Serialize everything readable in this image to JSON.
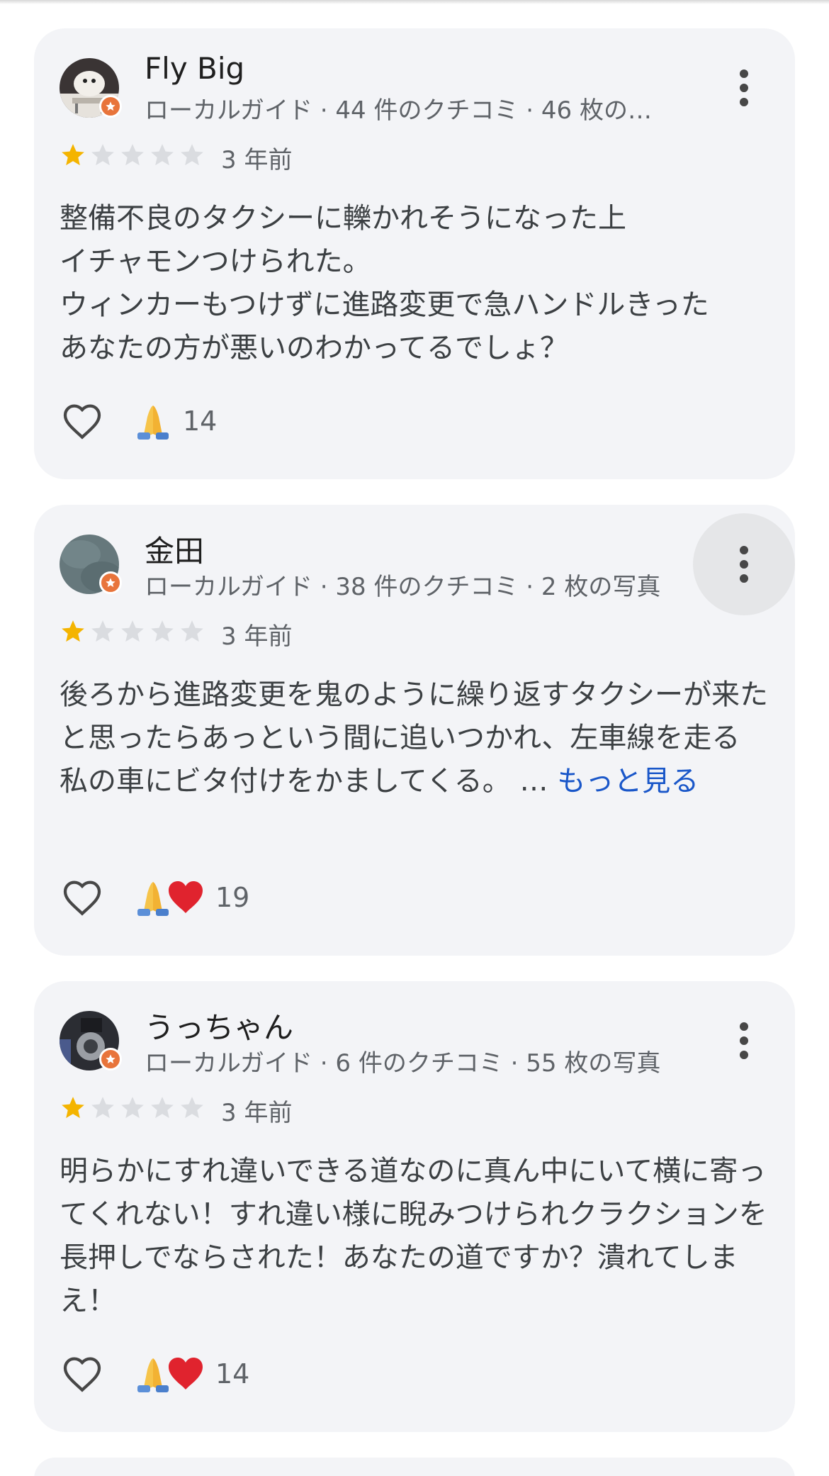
{
  "reviews": [
    {
      "name": "Fly Big",
      "meta": "ローカルガイド · 44 件のクチコミ · 46 枚の…",
      "rating": 1,
      "time": "3 年前",
      "text": "整備不良のタクシーに轢かれそうになった上\nイチャモンつけられた。\nウィンカーもつけずに進路変更で急ハンドルきった\nあなたの方が悪いのわかってるでしょ？",
      "more": "",
      "reactions": [
        "folded-hands-icon"
      ],
      "reaction_count": "14"
    },
    {
      "name": "金田",
      "meta": "ローカルガイド · 38 件のクチコミ · 2 枚の写真",
      "rating": 1,
      "time": "3 年前",
      "text": "後ろから進路変更を鬼のように繰り返すタクシーが来たと思ったらあっという間に追いつかれ、左車線を走る私の車にビタ付けをかましてくる。 … ",
      "more": "もっと見る",
      "reactions": [
        "folded-hands-icon",
        "red-heart-icon"
      ],
      "reaction_count": "19"
    },
    {
      "name": "うっちゃん",
      "meta": "ローカルガイド · 6 件のクチコミ · 55 枚の写真",
      "rating": 1,
      "time": "3 年前",
      "text": "明らかにすれ違いできる道なのに真ん中にいて横に寄ってくれない！すれ違い様に睨みつけられクラクションを長押しでならされた！あなたの道ですか？潰れてしまえ！",
      "more": "",
      "reactions": [
        "folded-hands-icon",
        "red-heart-icon"
      ],
      "reaction_count": "14"
    }
  ],
  "colors": {
    "card_bg": "#f3f4f7",
    "star_filled": "#f4b400",
    "star_empty": "#dadce0",
    "link": "#1a57c9",
    "guide_badge": "#e8743b"
  }
}
